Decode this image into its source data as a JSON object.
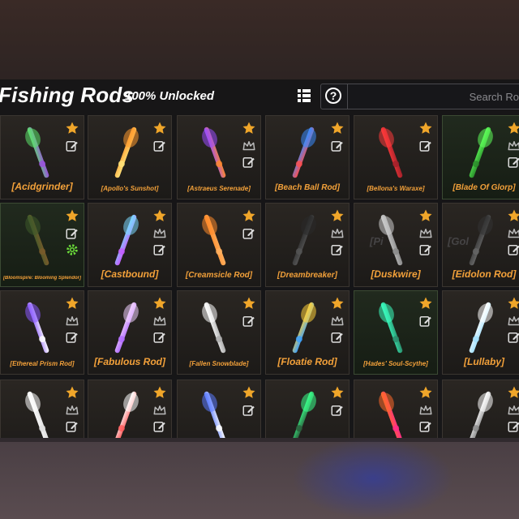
{
  "header": {
    "title": "Fishing Rods",
    "subtitle": "100% Unlocked",
    "search_placeholder": "Search Ro",
    "help_glyph": "?"
  },
  "colors": {
    "label": "#f3a13a",
    "star": "#f0a62a",
    "panel": "#141416"
  },
  "rows": [
    [
      {
        "name": "[Acidgrinder]",
        "size": "lg",
        "second_icon": "edit-icon",
        "third_icon": ""
      },
      {
        "name": "[Apollo's Sunshot]",
        "size": "sm",
        "second_icon": "edit-icon",
        "third_icon": ""
      },
      {
        "name": "[Astraeus Serenade]",
        "size": "sm",
        "second_icon": "crown-icon",
        "third_icon": "edit-icon"
      },
      {
        "name": "[Beach Ball Rod]",
        "size": "md",
        "second_icon": "edit-icon",
        "third_icon": ""
      },
      {
        "name": "[Bellona's Waraxe]",
        "size": "sm",
        "second_icon": "edit-icon",
        "third_icon": ""
      },
      {
        "name": "[Blade Of Glorp]",
        "size": "md",
        "second_icon": "crown-icon",
        "third_icon": "edit-icon"
      }
    ],
    [
      {
        "name": "[Bloomspire: Blooming Splendor]",
        "size": "xs",
        "second_icon": "edit-icon",
        "third_icon": "gear-icon"
      },
      {
        "name": "[Castbound]",
        "size": "lg",
        "second_icon": "crown-icon",
        "third_icon": "edit-icon"
      },
      {
        "name": "[Creamsicle Rod]",
        "size": "md",
        "second_icon": "edit-icon",
        "third_icon": ""
      },
      {
        "name": "[Dreambreaker]",
        "size": "md",
        "second_icon": "crown-icon",
        "third_icon": "edit-icon"
      },
      {
        "name": "[Duskwire]",
        "size": "lg",
        "second_icon": "crown-icon",
        "third_icon": "edit-icon"
      },
      {
        "name": "[Eidolon Rod]",
        "size": "lg",
        "second_icon": "crown-icon",
        "third_icon": "edit-icon"
      }
    ],
    [
      {
        "name": "[Ethereal Prism Rod]",
        "size": "sm",
        "second_icon": "crown-icon",
        "third_icon": "edit-icon"
      },
      {
        "name": "[Fabulous Rod]",
        "size": "lg",
        "second_icon": "crown-icon",
        "third_icon": "edit-icon"
      },
      {
        "name": "[Fallen Snowblade]",
        "size": "sm",
        "second_icon": "edit-icon",
        "third_icon": ""
      },
      {
        "name": "[Floatie Rod]",
        "size": "lg",
        "second_icon": "crown-icon",
        "third_icon": "edit-icon"
      },
      {
        "name": "[Hades' Soul-Scythe]",
        "size": "sm",
        "second_icon": "edit-icon",
        "third_icon": ""
      },
      {
        "name": "[Lullaby]",
        "size": "lg",
        "second_icon": "crown-icon",
        "third_icon": "edit-icon"
      }
    ],
    [
      {
        "name": "",
        "size": "lg",
        "second_icon": "crown-icon",
        "third_icon": "edit-icon"
      },
      {
        "name": "",
        "size": "lg",
        "second_icon": "crown-icon",
        "third_icon": "edit-icon"
      },
      {
        "name": "",
        "size": "lg",
        "second_icon": "edit-icon",
        "third_icon": ""
      },
      {
        "name": "",
        "size": "lg",
        "second_icon": "edit-icon",
        "third_icon": ""
      },
      {
        "name": "",
        "size": "lg",
        "second_icon": "crown-icon",
        "third_icon": "edit-icon"
      },
      {
        "name": "",
        "size": "lg",
        "second_icon": "crown-icon",
        "third_icon": "edit-icon"
      }
    ]
  ],
  "ghost_text": [
    "[Pi",
    "[Gol"
  ]
}
